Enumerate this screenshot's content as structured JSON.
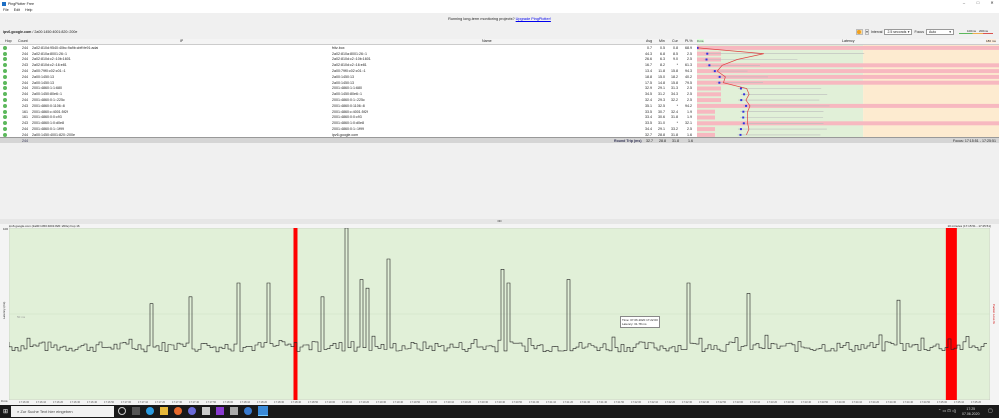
{
  "window": {
    "title": "PingPlotter Free",
    "controls": [
      "–",
      "□",
      "✕"
    ]
  },
  "menu": [
    "File",
    "Edit",
    "Help"
  ],
  "banner": {
    "text": "Running long-term monitoring projects?",
    "link": "Upgrade PingPlotter!"
  },
  "target": {
    "host": "ipv6.google.com",
    "ip": "/ 2a00:1450:4001:820::200e"
  },
  "controls": {
    "interval_label": "Interval",
    "interval": "2.5 seconds",
    "focus_label": "Focus",
    "focus": "Auto",
    "legend_100": "100ms",
    "legend_200": "200ms"
  },
  "columns": {
    "hop": "Hop",
    "count": "Count",
    "ip": "IP",
    "name": "Name",
    "avg": "Avg",
    "min": "Min",
    "cur": "Cur",
    "pl": "PL%",
    "latency": "Latency",
    "lat_min": "0 ms",
    "lat_max": "180 ms"
  },
  "hops": [
    {
      "hop": "1",
      "count": "244",
      "ip": "2a02:810d:9540:40bc:9a9b:cbff:fe91:adaf",
      "name": "fritz.box",
      "avg": "0.7",
      "min": "0.5",
      "cur": "0.8",
      "pl": "68.9"
    },
    {
      "hop": "2",
      "count": "244",
      "ip": "2a02:810a:8001:26::1",
      "name": "2a02:810a:8001:26::1",
      "avg": "44.3",
      "min": "6.8",
      "cur": "8.5",
      "pl": "2.5"
    },
    {
      "hop": "3",
      "count": "244",
      "ip": "2a02:810d:c2::10b:1601",
      "name": "2a02:810d:c2::10b:1601",
      "avg": "26.6",
      "min": "6.3",
      "cur": "9.0",
      "pl": "2.5"
    },
    {
      "hop": "4",
      "count": "243",
      "ip": "2a02:810d:c2::16:e81",
      "name": "2a02:810d:c2::16:e81",
      "avg": "16.7",
      "min": "8.2",
      "cur": "*",
      "pl": "61.3"
    },
    {
      "hop": "5",
      "count": "244",
      "ip": "2a00:79f0:c02:c01::1",
      "name": "2a00:79f0:c02:c01::1",
      "avg": "13.4",
      "min": "11.8",
      "cur": "15.8",
      "pl": "94.3"
    },
    {
      "hop": "6",
      "count": "244",
      "ip": "2a00:1450:13",
      "name": "2a00:1450:13",
      "avg": "18.8",
      "min": "15.0",
      "cur": "18.2",
      "pl": "40.2"
    },
    {
      "hop": "7",
      "count": "244",
      "ip": "2a00:1450:13",
      "name": "2a00:1450:13",
      "avg": "17.5",
      "min": "14.8",
      "cur": "15.8",
      "pl": "79.5"
    },
    {
      "hop": "8",
      "count": "244",
      "ip": "2001:4860:1:1:680",
      "name": "2001:4860:1:1:680",
      "avg": "32.9",
      "min": "29.1",
      "cur": "31.3",
      "pl": "2.5"
    },
    {
      "hop": "9",
      "count": "244",
      "ip": "2a00:1450:80e6::1",
      "name": "2a00:1450:80e6::1",
      "avg": "34.5",
      "min": "31.2",
      "cur": "34.3",
      "pl": "2.5"
    },
    {
      "hop": "10",
      "count": "244",
      "ip": "2001:4860:0:1::225c",
      "name": "2001:4860:0:1::225c",
      "avg": "32.4",
      "min": "29.3",
      "cur": "32.2",
      "pl": "2.5"
    },
    {
      "hop": "11",
      "count": "243",
      "ip": "2001:4860:0:1106::8",
      "name": "2001:4860:0:1106::8",
      "avg": "35.1",
      "min": "32.5",
      "cur": "*",
      "pl": "94.2"
    },
    {
      "hop": "12",
      "count": "161",
      "ip": "2001:4860:c:4001:5f2f",
      "name": "2001:4860:c:4001:5f2f",
      "avg": "33.5",
      "min": "30.7",
      "cur": "32.4",
      "pl": "1.9"
    },
    {
      "hop": "13",
      "count": "161",
      "ip": "2001:4860:0:0:c93",
      "name": "2001:4860:0:0:c93",
      "avg": "33.4",
      "min": "30.6",
      "cur": "31.8",
      "pl": "1.9"
    },
    {
      "hop": "14",
      "count": "243",
      "ip": "2001:4860:1:0:d0e8",
      "name": "2001:4860:1:0:d0e8",
      "avg": "33.5",
      "min": "31.0",
      "cur": "*",
      "pl": "32.1"
    },
    {
      "hop": "15",
      "count": "244",
      "ip": "2001:4860:0:1::1f99",
      "name": "2001:4860:0:1::1f99",
      "avg": "34.4",
      "min": "29.1",
      "cur": "33.2",
      "pl": "2.5"
    },
    {
      "hop": "16",
      "count": "244",
      "ip": "2a00:1450:4001:820::200e",
      "name": "ipv6.google.com",
      "avg": "32.7",
      "min": "28.8",
      "cur": "31.8",
      "pl": "1.6"
    }
  ],
  "summary": {
    "count": "244",
    "label": "Round Trip (ms)",
    "avg": "32.7",
    "min": "28.8",
    "cur": "31.8",
    "pl": "1.6",
    "focus": "Focus: 17:15:51 - 17:25:51"
  },
  "graph": {
    "title": "ipv6.google.com (2a00:1450:4001:820::200e) hop 16",
    "y_max": "100",
    "y_mid": "50 ms",
    "y_zero": "0 ms",
    "y_label": "Latency (ms)",
    "pl_label": "Packet Loss %",
    "range": "10 minutes (17:15:51 - 17:25:51)",
    "tooltip_time": "Time: 07.06.2020 17:22:00",
    "tooltip_latency": "Latency: 31.78 ms",
    "times": [
      "17:16:00",
      "17:16:10",
      "17:16:20",
      "17:16:30",
      "17:16:40",
      "17:16:50",
      "17:17:00",
      "17:17:10",
      "17:17:20",
      "17:17:30",
      "17:17:40",
      "17:17:50",
      "17:18:00",
      "17:18:10",
      "17:18:20",
      "17:18:30",
      "17:18:40",
      "17:18:50",
      "17:19:00",
      "17:19:10",
      "17:19:20",
      "17:19:30",
      "17:19:40",
      "17:19:50",
      "17:20:00",
      "17:20:10",
      "17:20:20",
      "17:20:30",
      "17:20:40",
      "17:20:50",
      "17:21:00",
      "17:21:10",
      "17:21:20",
      "17:21:30",
      "17:21:40",
      "17:21:50",
      "17:22:00",
      "17:22:10",
      "17:22:20",
      "17:22:30",
      "17:22:40",
      "17:22:50",
      "17:23:00",
      "17:23:10",
      "17:23:20",
      "17:23:30",
      "17:23:40",
      "17:23:50",
      "17:24:00",
      "17:24:10",
      "17:24:20",
      "17:24:30",
      "17:24:40",
      "17:24:50",
      "17:25:00",
      "17:25:10",
      "17:25:20"
    ],
    "loss_fraction_positions": [
      0.29,
      0.955
    ]
  },
  "taskbar": {
    "search": "Zur Suche Text hier eingeben",
    "time": "17:25",
    "date": "07.06.2020"
  }
}
